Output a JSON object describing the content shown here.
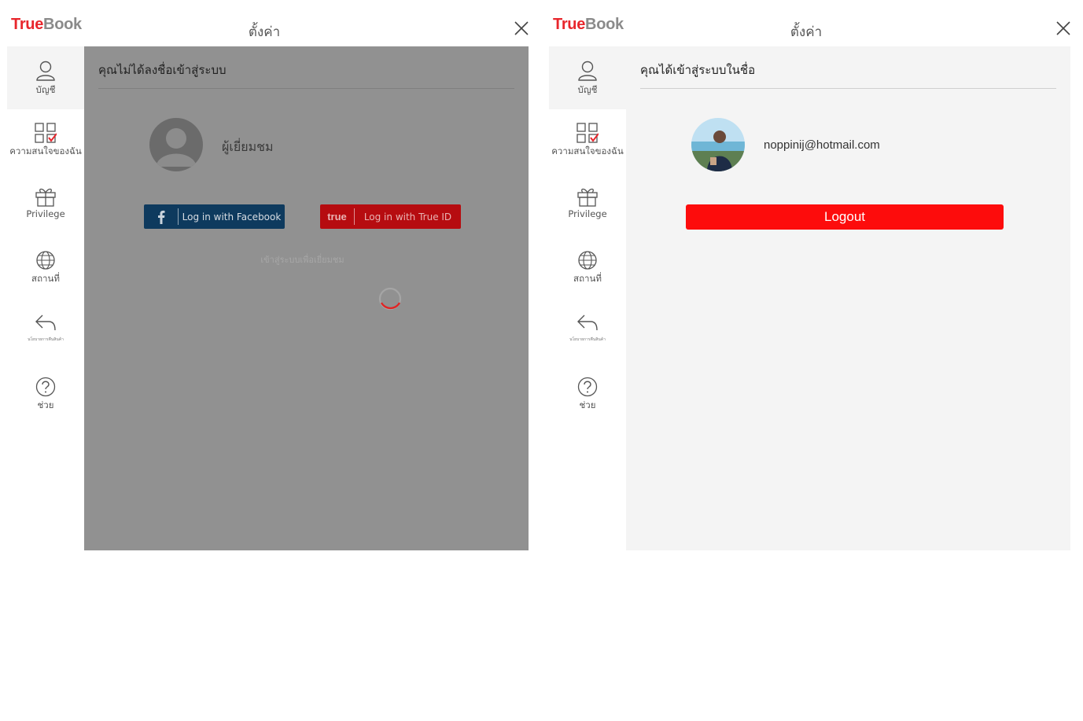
{
  "brand": {
    "part1": "True",
    "part2": "Book"
  },
  "settings_title": "ตั้งค่า",
  "sidebar": {
    "items": [
      {
        "label": "บัญชี",
        "icon": "person-icon"
      },
      {
        "label": "ความสนใจของฉัน",
        "icon": "interests-grid-icon"
      },
      {
        "label": "Privilege",
        "icon": "gift-icon"
      },
      {
        "label": "สถานที่",
        "icon": "globe-icon"
      },
      {
        "label": "นโยบายการคืนสินค้า",
        "icon": "return-arrow-icon"
      },
      {
        "label": "ช่วย",
        "icon": "help-icon"
      }
    ]
  },
  "left": {
    "heading": "คุณไม่ได้ลงชื่อเข้าสู่ระบบ",
    "guest_name": "ผู้เยี่ยมชม",
    "facebook_button": "Log in with Facebook",
    "trueid_badge": "true",
    "trueid_button": "Log in with True ID",
    "guest_link": "เข้าสู่ระบบเพื่อเยี่ยมชม",
    "overlay_color": "#919191"
  },
  "right": {
    "heading": "คุณได้เข้าสู่ระบบในชื่อ",
    "email": "noppinij@hotmail.com",
    "logout_button": "Logout"
  },
  "colors": {
    "brand_red": "#e8262c",
    "logout_red": "#fd0c0c",
    "facebook_blue": "#0e3a5e",
    "trueid_red": "#b60c10"
  }
}
